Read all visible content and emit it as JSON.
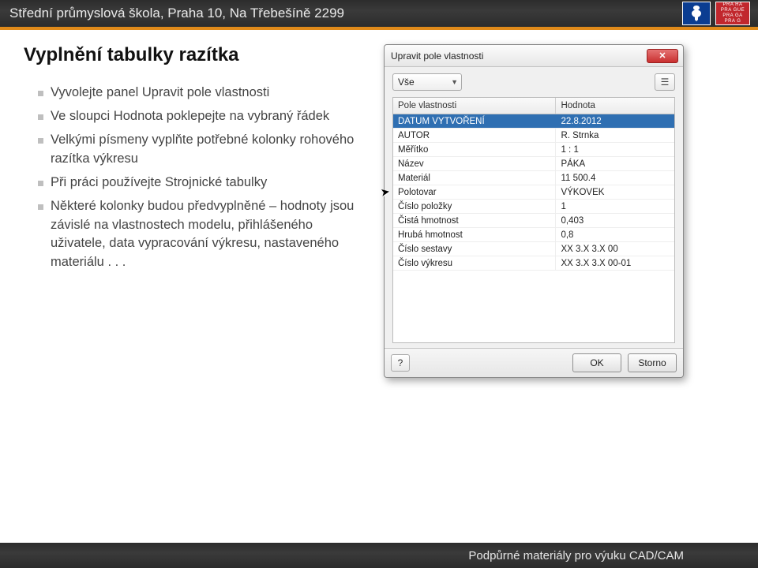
{
  "header": {
    "title": "Střední průmyslová škola, Praha 10, Na Třebešíně 2299",
    "praha_lines": [
      "PRA HA",
      "PRA GUE",
      "PRA GA",
      "PRA G"
    ]
  },
  "page": {
    "title": "Vyplnění tabulky razítka"
  },
  "bullets": [
    "Vyvolejte panel Upravit pole vlastnosti",
    "Ve sloupci Hodnota poklepejte na vybraný řádek",
    "Velkými písmeny vyplňte potřebné kolonky rohového razítka výkresu",
    "Při práci používejte Strojnické tabulky",
    "Některé kolonky budou předvyplněné – hodnoty jsou závislé na vlastnostech modelu, přihlášeného uživatele, data vypracování výkresu, nastaveného materiálu . . ."
  ],
  "dialog": {
    "title": "Upravit pole vlastnosti",
    "combo_value": "Vše",
    "columns": {
      "c1": "Pole vlastnosti",
      "c2": "Hodnota"
    },
    "rows": [
      {
        "k": "DATUM VYTVOŘENÍ",
        "v": "22.8.2012",
        "selected": true
      },
      {
        "k": "AUTOR",
        "v": "R. Strnka"
      },
      {
        "k": "Měřítko",
        "v": "1 : 1"
      },
      {
        "k": "Název",
        "v": "PÁKA"
      },
      {
        "k": "Materiál",
        "v": "11 500.4"
      },
      {
        "k": "Polotovar",
        "v": "VÝKOVEK"
      },
      {
        "k": "Číslo položky",
        "v": "1"
      },
      {
        "k": "Čistá hmotnost",
        "v": "0,403"
      },
      {
        "k": "Hrubá hmotnost",
        "v": "0,8"
      },
      {
        "k": "Číslo sestavy",
        "v": "XX 3.X 3.X 00"
      },
      {
        "k": "Číslo výkresu",
        "v": "XX 3.X 3.X 00-01"
      }
    ],
    "ok": "OK",
    "cancel": "Storno"
  },
  "footer": {
    "text": "Podpůrné materiály pro výuku CAD/CAM"
  }
}
